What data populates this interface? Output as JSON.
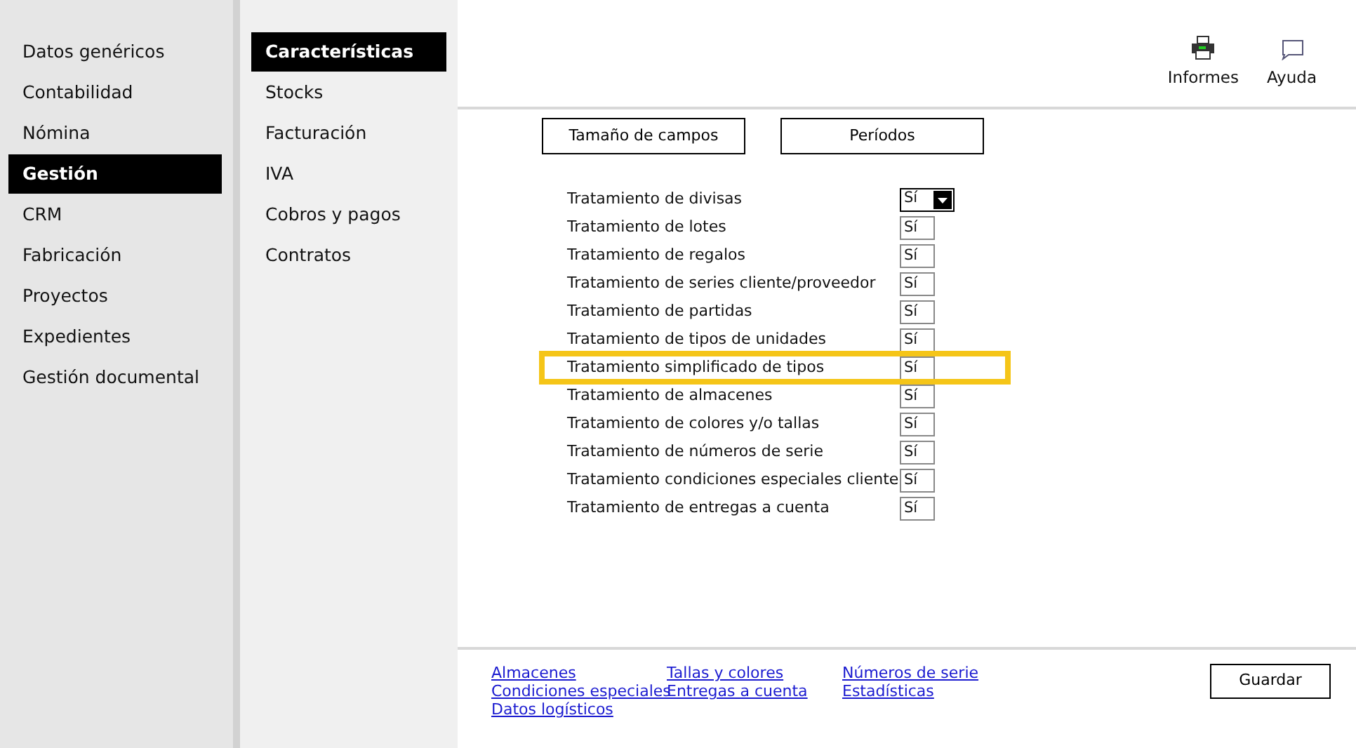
{
  "main_menu": [
    {
      "label": "Datos genéricos",
      "selected": false
    },
    {
      "label": "Contabilidad",
      "selected": false
    },
    {
      "label": "Nómina",
      "selected": false
    },
    {
      "label": "Gestión",
      "selected": true
    },
    {
      "label": "CRM",
      "selected": false
    },
    {
      "label": "Fabricación",
      "selected": false
    },
    {
      "label": "Proyectos",
      "selected": false
    },
    {
      "label": "Expedientes",
      "selected": false
    },
    {
      "label": "Gestión documental",
      "selected": false
    }
  ],
  "sub_menu": [
    {
      "label": "Características",
      "selected": true
    },
    {
      "label": "Stocks",
      "selected": false
    },
    {
      "label": "Facturación",
      "selected": false
    },
    {
      "label": "IVA",
      "selected": false
    },
    {
      "label": "Cobros y pagos",
      "selected": false
    },
    {
      "label": "Contratos",
      "selected": false
    }
  ],
  "toolbar": [
    {
      "kind": "print",
      "label": "Informes"
    },
    {
      "kind": "help",
      "label": "Ayuda"
    }
  ],
  "buttons": [
    "Tamaño de campos",
    "Períodos"
  ],
  "settings": [
    {
      "label": "Tratamiento de divisas",
      "value": "Sí",
      "kind": "dropdown",
      "highlighted": false
    },
    {
      "label": "Tratamiento de lotes",
      "value": "Sí",
      "kind": "field",
      "highlighted": false
    },
    {
      "label": "Tratamiento de regalos",
      "value": "Sí",
      "kind": "field",
      "highlighted": false
    },
    {
      "label": "Tratamiento de series cliente/proveedor",
      "value": "Sí",
      "kind": "field",
      "highlighted": false
    },
    {
      "label": "Tratamiento de partidas",
      "value": "Sí",
      "kind": "field",
      "highlighted": false
    },
    {
      "label": "Tratamiento de tipos de unidades",
      "value": "Sí",
      "kind": "field",
      "highlighted": false
    },
    {
      "label": "Tratamiento simplificado de tipos",
      "value": "Sí",
      "kind": "field",
      "highlighted": true
    },
    {
      "label": "Tratamiento de almacenes",
      "value": "Sí",
      "kind": "field",
      "highlighted": false
    },
    {
      "label": "Tratamiento de colores y/o tallas",
      "value": "Sí",
      "kind": "field",
      "highlighted": false
    },
    {
      "label": "Tratamiento de números de serie",
      "value": "Sí",
      "kind": "field",
      "highlighted": false
    },
    {
      "label": "Tratamiento condiciones especiales cliente",
      "value": "Sí",
      "kind": "field",
      "highlighted": false
    },
    {
      "label": "Tratamiento de entregas a cuenta",
      "value": "Sí",
      "kind": "field",
      "highlighted": false
    }
  ],
  "footer_links": [
    [
      "Almacenes",
      "Condiciones especiales",
      "Datos logísticos"
    ],
    [
      "Tallas y colores",
      "Entregas a cuenta"
    ],
    [
      "Números de serie",
      "Estadísticas"
    ]
  ],
  "save_button": "Guardar"
}
